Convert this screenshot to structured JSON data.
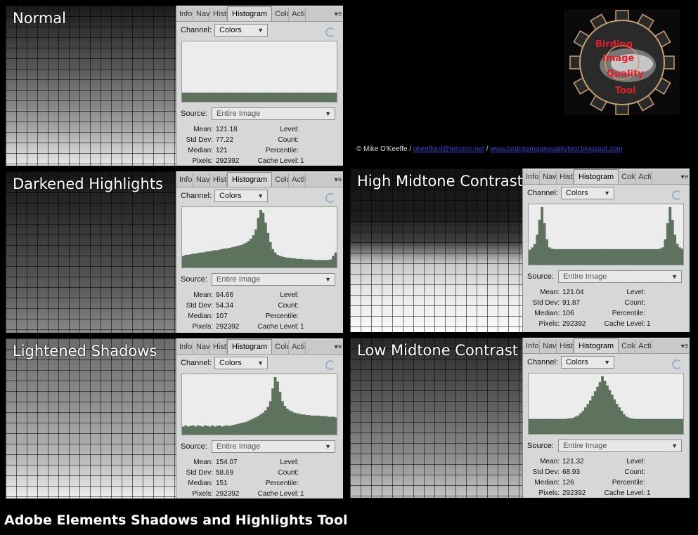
{
  "footer_title": "Adobe Elements Shadows and Highlights Tool",
  "credit": {
    "author": "© Mike O'Keeffe",
    "separator": "/",
    "email": "okeefford@telrcom.net",
    "blog": "www.birdingimagequalitytool.blogspot.com"
  },
  "logo": {
    "lines": [
      "Birding",
      "Image",
      "Quality",
      "Tool"
    ],
    "colors": {
      "text": "#e0202a",
      "gear": "#2a2a2a",
      "outline": "#c8a070"
    }
  },
  "panel_labels": {
    "tabs": [
      "Info",
      "Navig",
      "Histo",
      "Histogram",
      "Color",
      "Actic"
    ],
    "menu_glyph": "▾≡",
    "channel_label": "Channel:",
    "channel_value": "Colors",
    "source_label": "Source:",
    "source_value": "Entire Image",
    "mean": "Mean:",
    "std_dev": "Std Dev:",
    "median": "Median:",
    "pixels": "Pixels:",
    "level": "Level:",
    "count": "Count:",
    "percentile": "Percentile:",
    "cache_level": "Cache Level:"
  },
  "colors": {
    "histogram_fill": "#5d735e",
    "panel_bg": "#d6d7d7"
  },
  "examples": [
    {
      "title": "Normal",
      "mean": "121.18",
      "std_dev": "77.22",
      "median": "121",
      "pixels": "292392",
      "cache_level": "1",
      "tone": "normal",
      "histogram": [
        0.16,
        0.16,
        0.16,
        0.16,
        0.16,
        0.16,
        0.16,
        0.16,
        0.16,
        0.16,
        0.16,
        0.16,
        0.16,
        0.16,
        0.16,
        0.16,
        0.16,
        0.16,
        0.16,
        0.16,
        0.16,
        0.16,
        0.16,
        0.16,
        0.16,
        0.16,
        0.16,
        0.16,
        0.16,
        0.16,
        0.16,
        0.16,
        0.16,
        0.16,
        0.16,
        0.16,
        0.16,
        0.16,
        0.16,
        0.16,
        0.16,
        0.16,
        0.16,
        0.16,
        0.16,
        0.16,
        0.16,
        0.16,
        0.16,
        0.16,
        0.16,
        0.16,
        0.16,
        0.16,
        0.16,
        0.16,
        0.16,
        0.16,
        0.16,
        0.16,
        0.16,
        0.16,
        0.16,
        0.16
      ]
    },
    {
      "title": "Darkened Highlights",
      "mean": "94.66",
      "std_dev": "54.34",
      "median": "107",
      "pixels": "292392",
      "cache_level": "1",
      "tone": "dark",
      "histogram": [
        0.2,
        0.22,
        0.22,
        0.23,
        0.24,
        0.24,
        0.25,
        0.26,
        0.26,
        0.27,
        0.28,
        0.28,
        0.29,
        0.3,
        0.3,
        0.31,
        0.32,
        0.33,
        0.33,
        0.34,
        0.35,
        0.36,
        0.37,
        0.38,
        0.39,
        0.41,
        0.43,
        0.46,
        0.5,
        0.56,
        0.66,
        0.86,
        1.0,
        0.95,
        0.78,
        0.6,
        0.44,
        0.32,
        0.26,
        0.22,
        0.2,
        0.19,
        0.18,
        0.17,
        0.17,
        0.16,
        0.16,
        0.15,
        0.15,
        0.15,
        0.14,
        0.14,
        0.14,
        0.14,
        0.13,
        0.13,
        0.13,
        0.13,
        0.13,
        0.13,
        0.13,
        0.14,
        0.2,
        0.26
      ]
    },
    {
      "title": "High Midtone Contrast",
      "mean": "121.04",
      "std_dev": "91.87",
      "median": "106",
      "pixels": "292392",
      "cache_level": "1",
      "tone": "high",
      "histogram": [
        0.26,
        0.3,
        0.36,
        0.52,
        0.78,
        1.0,
        0.72,
        0.44,
        0.3,
        0.28,
        0.27,
        0.27,
        0.27,
        0.27,
        0.27,
        0.27,
        0.27,
        0.27,
        0.27,
        0.27,
        0.27,
        0.27,
        0.27,
        0.27,
        0.27,
        0.27,
        0.27,
        0.27,
        0.27,
        0.27,
        0.27,
        0.27,
        0.27,
        0.27,
        0.27,
        0.27,
        0.27,
        0.27,
        0.27,
        0.27,
        0.27,
        0.27,
        0.27,
        0.27,
        0.27,
        0.27,
        0.27,
        0.27,
        0.27,
        0.27,
        0.27,
        0.27,
        0.27,
        0.27,
        0.28,
        0.3,
        0.44,
        0.72,
        1.0,
        0.78,
        0.52,
        0.36,
        0.3,
        0.28
      ]
    },
    {
      "title": "Lightened Shadows",
      "mean": "154.07",
      "std_dev": "58.69",
      "median": "151",
      "pixels": "292392",
      "cache_level": "1",
      "tone": "light",
      "histogram": [
        0.14,
        0.16,
        0.14,
        0.15,
        0.16,
        0.14,
        0.16,
        0.15,
        0.14,
        0.16,
        0.15,
        0.14,
        0.16,
        0.14,
        0.15,
        0.16,
        0.14,
        0.15,
        0.16,
        0.15,
        0.16,
        0.17,
        0.18,
        0.19,
        0.2,
        0.21,
        0.22,
        0.24,
        0.26,
        0.28,
        0.3,
        0.32,
        0.35,
        0.38,
        0.42,
        0.48,
        0.58,
        0.8,
        1.0,
        0.92,
        0.74,
        0.58,
        0.5,
        0.45,
        0.42,
        0.4,
        0.38,
        0.37,
        0.36,
        0.35,
        0.35,
        0.34,
        0.34,
        0.33,
        0.33,
        0.33,
        0.33,
        0.32,
        0.32,
        0.32,
        0.31,
        0.31,
        0.31,
        0.3
      ]
    },
    {
      "title": "Low Midtone Contrast",
      "mean": "121.32",
      "std_dev": "68.93",
      "median": "126",
      "pixels": "292392",
      "cache_level": "1",
      "tone": "low",
      "histogram": [
        0.26,
        0.26,
        0.26,
        0.26,
        0.26,
        0.26,
        0.26,
        0.26,
        0.26,
        0.26,
        0.26,
        0.26,
        0.26,
        0.26,
        0.26,
        0.26,
        0.27,
        0.27,
        0.28,
        0.3,
        0.32,
        0.36,
        0.4,
        0.46,
        0.52,
        0.58,
        0.66,
        0.74,
        0.82,
        0.9,
        1.0,
        0.92,
        0.84,
        0.76,
        0.68,
        0.6,
        0.52,
        0.46,
        0.4,
        0.34,
        0.3,
        0.28,
        0.27,
        0.26,
        0.26,
        0.26,
        0.26,
        0.26,
        0.26,
        0.26,
        0.26,
        0.26,
        0.26,
        0.26,
        0.26,
        0.26,
        0.26,
        0.26,
        0.26,
        0.26,
        0.26,
        0.26,
        0.26,
        0.26
      ]
    }
  ]
}
